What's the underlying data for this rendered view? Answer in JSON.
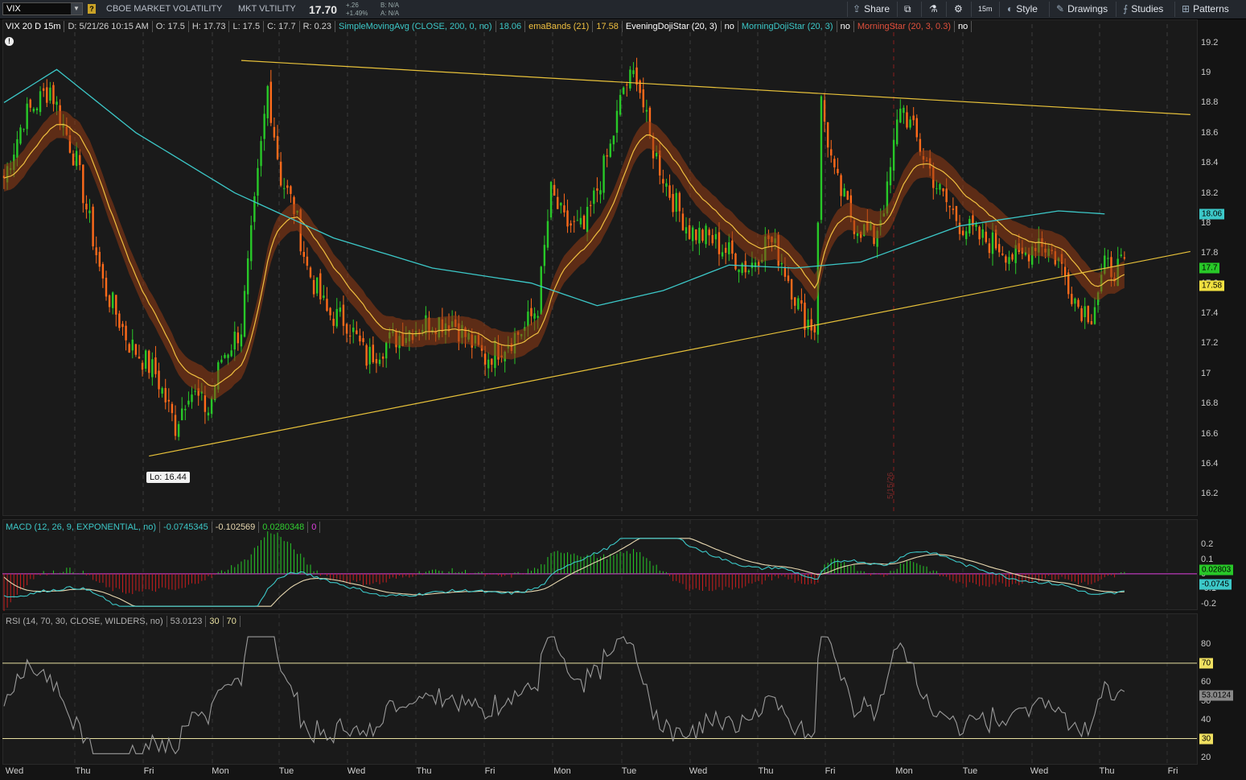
{
  "toolbar": {
    "symbol": "VIX",
    "help": "?",
    "name1": "CBOE MARKET VOLATILITY",
    "name2": "MKT VLTILITY",
    "price": "17.70",
    "change": "+.26",
    "change_pct": "+1.49%",
    "bid": "B: N/A",
    "ask": "A: N/A",
    "share": "Share",
    "interval": "15m",
    "style": "Style",
    "drawings": "Drawings",
    "studies": "Studies",
    "patterns": "Patterns"
  },
  "price_header": [
    {
      "text": "VIX 20 D 15m",
      "color": "#ffffff"
    },
    {
      "text": "D: 5/21/26 10:15 AM",
      "color": "#d0d0d0"
    },
    {
      "text": "O: 17.5",
      "color": "#d0d0d0"
    },
    {
      "text": "H: 17.73",
      "color": "#d0d0d0"
    },
    {
      "text": "L: 17.5",
      "color": "#d0d0d0"
    },
    {
      "text": "C: 17.7",
      "color": "#d0d0d0"
    },
    {
      "text": "R: 0.23",
      "color": "#d0d0d0"
    },
    {
      "text": "SimpleMovingAvg (CLOSE, 200, 0, no)",
      "color": "#3cc8c8"
    },
    {
      "text": "18.06",
      "color": "#3cc8c8"
    },
    {
      "text": "emaBands (21)",
      "color": "#f0c040"
    },
    {
      "text": "17.58",
      "color": "#f0c040"
    },
    {
      "text": "EveningDojiStar (20, 3)",
      "color": "#ffffff"
    },
    {
      "text": "no",
      "color": "#ffffff"
    },
    {
      "text": "MorningDojiStar (20, 3)",
      "color": "#3cc8c8"
    },
    {
      "text": "no",
      "color": "#ffffff"
    },
    {
      "text": "MorningStar (20, 3, 0.3)",
      "color": "#e0503c"
    },
    {
      "text": "no",
      "color": "#ffffff"
    }
  ],
  "macd_header": [
    {
      "text": "MACD (12, 26, 9, EXPONENTIAL, no)",
      "color": "#3cc8c8"
    },
    {
      "text": "-0.0745345",
      "color": "#3cc8c8"
    },
    {
      "text": "-0.102569",
      "color": "#e8d8b0"
    },
    {
      "text": "0.0280348",
      "color": "#30d030"
    },
    {
      "text": "0",
      "color": "#e040e0"
    }
  ],
  "rsi_header": [
    {
      "text": "RSI (14, 70, 30, CLOSE, WILDERS, no)",
      "color": "#b0b0b0"
    },
    {
      "text": "53.0123",
      "color": "#b0b0b0"
    },
    {
      "text": "30",
      "color": "#e8e0a0"
    },
    {
      "text": "70",
      "color": "#e8e0a0"
    }
  ],
  "lo_label": "Lo: 16.44",
  "date_marker": "5/15/26",
  "chart_data": [
    {
      "type": "candlestick",
      "symbol": "VIX",
      "interval": "15m",
      "days": [
        "Wed",
        "Thu",
        "Fri",
        "Mon",
        "Tue",
        "Wed",
        "Thu",
        "Fri",
        "Mon",
        "Tue",
        "Wed",
        "Thu",
        "Fri"
      ],
      "ylim": [
        16.1,
        19.3
      ],
      "yticks": [
        16.2,
        16.4,
        16.6,
        16.8,
        17,
        17.2,
        17.4,
        17.6,
        17.8,
        18,
        18.2,
        18.4,
        18.6,
        18.8,
        19,
        19.2
      ],
      "price_path": [
        [
          0,
          18.3
        ],
        [
          6,
          18.7
        ],
        [
          14,
          18.9
        ],
        [
          22,
          18.4
        ],
        [
          30,
          17.6
        ],
        [
          38,
          17.2
        ],
        [
          46,
          17.0
        ],
        [
          52,
          16.65
        ],
        [
          56,
          16.9
        ],
        [
          62,
          16.75
        ],
        [
          66,
          17.1
        ],
        [
          72,
          17.3
        ],
        [
          76,
          18.1
        ],
        [
          80,
          18.9
        ],
        [
          84,
          18.3
        ],
        [
          88,
          18.1
        ],
        [
          92,
          17.7
        ],
        [
          98,
          17.4
        ],
        [
          104,
          17.35
        ],
        [
          110,
          17.1
        ],
        [
          116,
          17.2
        ],
        [
          120,
          17.25
        ],
        [
          124,
          17.3
        ],
        [
          130,
          17.35
        ],
        [
          136,
          17.35
        ],
        [
          140,
          17.25
        ],
        [
          146,
          17.1
        ],
        [
          152,
          17.2
        ],
        [
          158,
          17.3
        ],
        [
          162,
          17.45
        ],
        [
          166,
          18.2
        ],
        [
          170,
          18.0
        ],
        [
          176,
          17.95
        ],
        [
          184,
          18.5
        ],
        [
          188,
          18.9
        ],
        [
          192,
          19.0
        ],
        [
          196,
          18.55
        ],
        [
          202,
          18.2
        ],
        [
          208,
          17.95
        ],
        [
          214,
          17.9
        ],
        [
          220,
          17.8
        ],
        [
          226,
          17.7
        ],
        [
          232,
          17.9
        ],
        [
          236,
          17.75
        ],
        [
          242,
          17.4
        ],
        [
          246,
          17.3
        ],
        [
          248,
          18.8
        ],
        [
          252,
          18.3
        ],
        [
          258,
          18.0
        ],
        [
          264,
          17.9
        ],
        [
          268,
          18.2
        ],
        [
          272,
          18.8
        ],
        [
          278,
          18.5
        ],
        [
          284,
          18.2
        ],
        [
          290,
          18.0
        ],
        [
          296,
          17.9
        ],
        [
          302,
          17.85
        ],
        [
          308,
          17.75
        ],
        [
          314,
          17.9
        ],
        [
          320,
          17.75
        ],
        [
          326,
          17.45
        ],
        [
          330,
          17.4
        ],
        [
          334,
          17.7
        ]
      ],
      "total_bars": 340,
      "series": [
        {
          "name": "SimpleMovingAvg (CLOSE, 200, 0, no)",
          "last": 18.06,
          "color": "#3cc8c8",
          "path": [
            [
              0,
              18.8
            ],
            [
              16,
              19.02
            ],
            [
              40,
              18.6
            ],
            [
              70,
              18.2
            ],
            [
              100,
              17.9
            ],
            [
              130,
              17.7
            ],
            [
              160,
              17.6
            ],
            [
              180,
              17.45
            ],
            [
              200,
              17.55
            ],
            [
              220,
              17.72
            ],
            [
              240,
              17.7
            ],
            [
              260,
              17.74
            ],
            [
              290,
              17.98
            ],
            [
              320,
              18.08
            ],
            [
              334,
              18.06
            ]
          ]
        },
        {
          "name": "emaBands (21)",
          "last": 17.58,
          "color": "#f0c040"
        }
      ],
      "trendlines": [
        {
          "color": "#e8c23a",
          "from": [
            72,
            19.08
          ],
          "to": [
            360,
            18.72
          ]
        },
        {
          "color": "#e8c23a",
          "from": [
            44,
            16.45
          ],
          "to": [
            360,
            17.81
          ]
        }
      ],
      "last_price": 17.7
    },
    {
      "type": "line",
      "title": "MACD (12, 26, 9, EXPONENTIAL, no)",
      "yticks": [
        0.2,
        0.1,
        0,
        -0.1,
        -0.2
      ],
      "ylim": [
        -0.23,
        0.25
      ],
      "series": [
        {
          "name": "Value",
          "last": -0.0745345,
          "color": "#3cc8c8"
        },
        {
          "name": "Avg",
          "last": -0.102569,
          "color": "#e8d8b0"
        },
        {
          "name": "Diff",
          "last": 0.0280348,
          "color": "#30d030"
        },
        {
          "name": "ZeroLine",
          "last": 0,
          "color": "#e040e0"
        }
      ],
      "value_label": "-0.0745",
      "diff_label": "0.02803"
    },
    {
      "type": "line",
      "title": "RSI (14, 70, 30, CLOSE, WILDERS, no)",
      "yticks": [
        80,
        70,
        60,
        50,
        40,
        30,
        20
      ],
      "ylim": [
        17,
        87
      ],
      "overbought": 70,
      "oversold": 30,
      "last": 53.0123,
      "last_label": "53.0124"
    }
  ]
}
